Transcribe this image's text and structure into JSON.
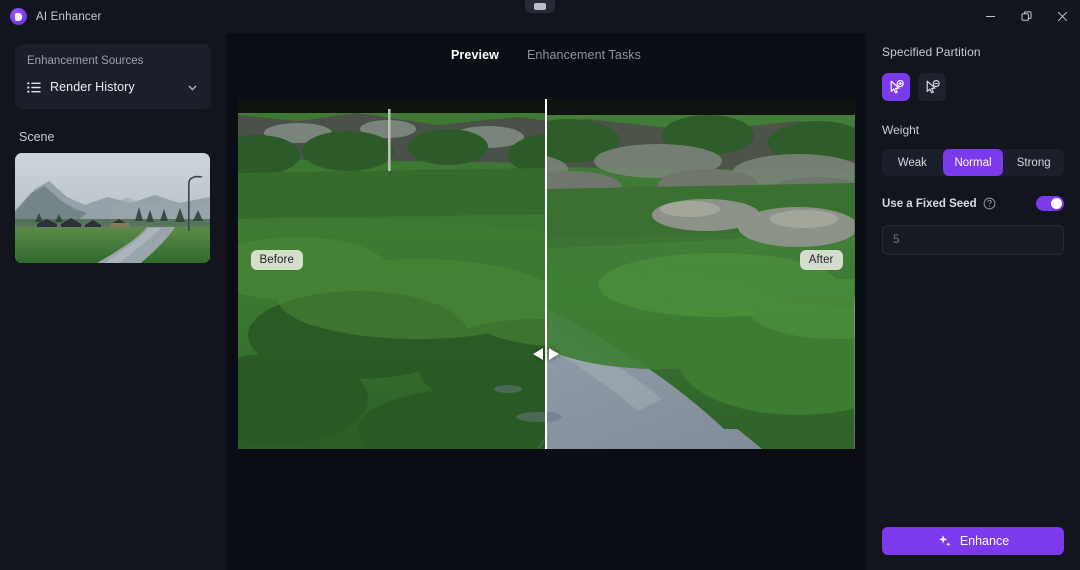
{
  "window": {
    "app_title": "AI Enhancer",
    "logo_icon": "app-logo-icon",
    "minimize_icon": "minimize-icon",
    "restore_icon": "restore-icon",
    "close_icon": "close-icon",
    "accent_color": "#7c3aed",
    "titlebar_color": "#12151d",
    "canvas_color": "#0a0d14"
  },
  "sidebar": {
    "sources_label": "Enhancement Sources",
    "source_icon": "list-icon",
    "source_value": "Render History",
    "chevron_icon": "chevron-down-icon",
    "scene_label": "Scene",
    "thumbnail_alt": "misty mountain village with rice field and road"
  },
  "center": {
    "tabs": [
      {
        "label": "Preview",
        "active": true
      },
      {
        "label": "Enhancement Tasks",
        "active": false
      }
    ],
    "before_label": "Before",
    "after_label": "After",
    "handle_icon": "left-right-arrows-icon",
    "divider_position_percent": 50
  },
  "right": {
    "partition_title": "Specified Partition",
    "partition_add_icon": "cursor-plus-icon",
    "partition_remove_icon": "cursor-minus-icon",
    "weight_title": "Weight",
    "weight_options": [
      {
        "label": "Weak",
        "active": false
      },
      {
        "label": "Normal",
        "active": true
      },
      {
        "label": "Strong",
        "active": false
      }
    ],
    "fixed_seed_label": "Use a Fixed Seed",
    "help_icon": "help-circle-icon",
    "toggle_state": "on",
    "seed_placeholder": "5",
    "seed_value": "",
    "enhance_label": "Enhance",
    "enhance_icon": "sparkle-icon"
  }
}
